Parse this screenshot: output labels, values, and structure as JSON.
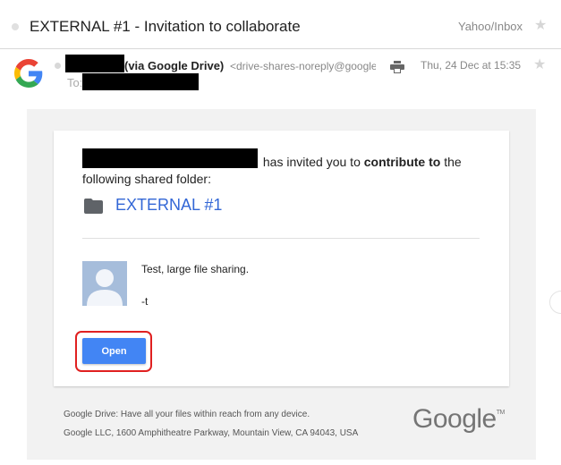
{
  "subject": "EXTERNAL #1 - Invitation to collaborate",
  "folder_path": "Yahoo/Inbox",
  "sender": {
    "via": "(via Google Drive)",
    "address": "<drive-shares-noreply@google.com>",
    "to_label": "To:"
  },
  "date": "Thu, 24 Dec at 15:35",
  "icons": {
    "star": "star-icon",
    "print": "print-icon",
    "folder": "folder-icon",
    "google_g": "google-g-icon",
    "avatar": "person-avatar-icon"
  },
  "invite": {
    "before_bold": "has invited you to",
    "bold": "contribute to",
    "after_bold": "the following shared folder:"
  },
  "shared_folder": "EXTERNAL #1",
  "message_lines": [
    "Test, large file sharing.",
    "-t"
  ],
  "open_button": "Open",
  "footer": {
    "line1": "Google Drive: Have all your files within reach from any device.",
    "line2": "Google LLC, 1600 Amphitheatre Parkway, Mountain View, CA 94043, USA",
    "logo": "Google",
    "logo_tm": "TM"
  },
  "colors": {
    "accent": "#3367d6",
    "button": "#4285f4",
    "highlight": "#e02020"
  }
}
